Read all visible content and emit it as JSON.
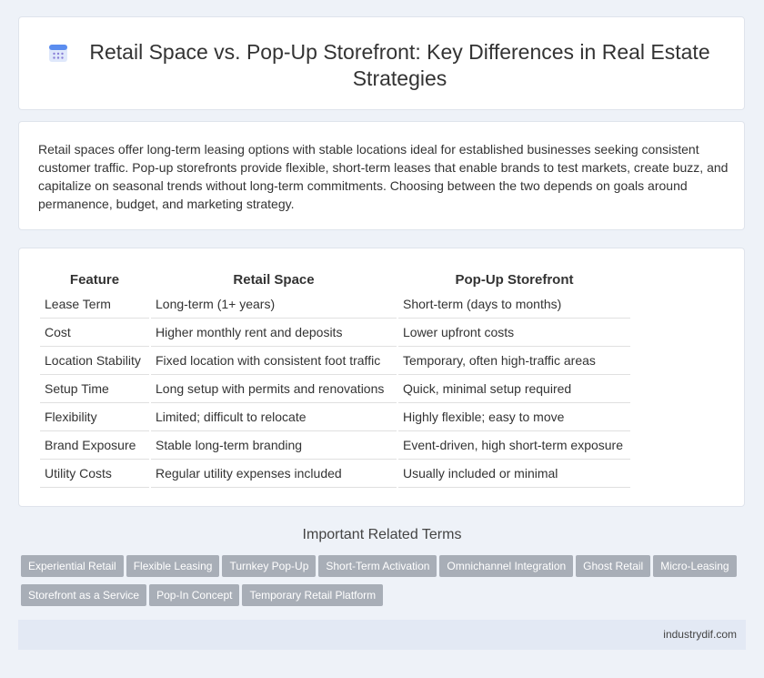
{
  "header": {
    "title": "Retail Space vs. Pop-Up Storefront: Key Differences in Real Estate Strategies",
    "icon": "calendar-icon"
  },
  "intro": {
    "text": "Retail spaces offer long-term leasing options with stable locations ideal for established businesses seeking consistent customer traffic. Pop-up storefronts provide flexible, short-term leases that enable brands to test markets, create buzz, and capitalize on seasonal trends without long-term commitments. Choosing between the two depends on goals around permanence, budget, and marketing strategy."
  },
  "table": {
    "headers": [
      "Feature",
      "Retail Space",
      "Pop-Up Storefront"
    ],
    "rows": [
      [
        "Lease Term",
        "Long-term (1+ years)",
        "Short-term (days to months)"
      ],
      [
        "Cost",
        "Higher monthly rent and deposits",
        "Lower upfront costs"
      ],
      [
        "Location Stability",
        "Fixed location with consistent foot traffic",
        "Temporary, often high-traffic areas"
      ],
      [
        "Setup Time",
        "Long setup with permits and renovations",
        "Quick, minimal setup required"
      ],
      [
        "Flexibility",
        "Limited; difficult to relocate",
        "Highly flexible; easy to move"
      ],
      [
        "Brand Exposure",
        "Stable long-term branding",
        "Event-driven, high short-term exposure"
      ],
      [
        "Utility Costs",
        "Regular utility expenses included",
        "Usually included or minimal"
      ]
    ]
  },
  "related": {
    "title": "Important Related Terms",
    "tags": [
      "Experiential Retail",
      "Flexible Leasing",
      "Turnkey Pop-Up",
      "Short-Term Activation",
      "Omnichannel Integration",
      "Ghost Retail",
      "Micro-Leasing",
      "Storefront as a Service",
      "Pop-In Concept",
      "Temporary Retail Platform"
    ]
  },
  "footer": {
    "text": "industrydif.com"
  },
  "colors": {
    "background": "#eef2f8",
    "tag": "#a8aeb7",
    "icon_accent": "#5b8def"
  }
}
